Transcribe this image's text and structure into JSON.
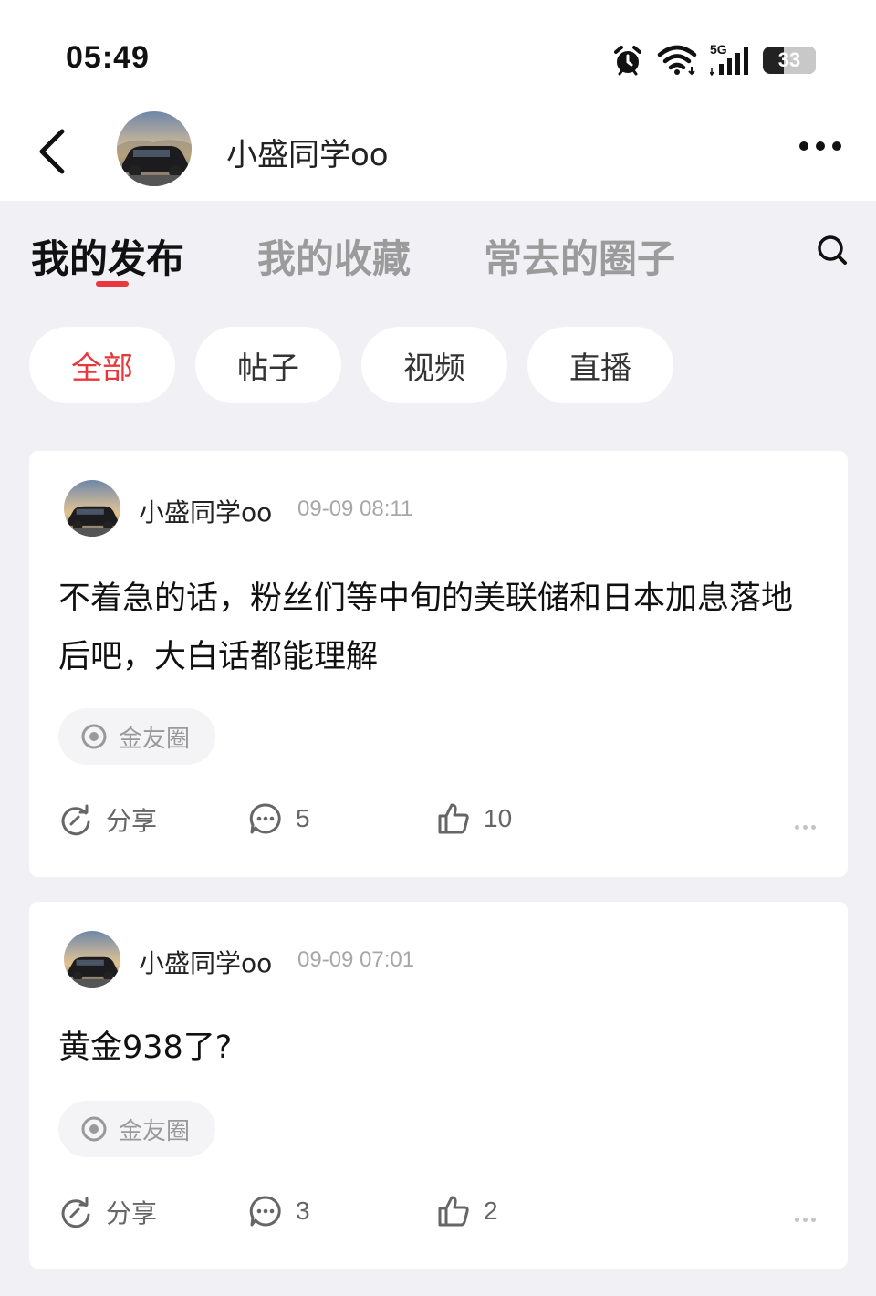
{
  "status_bar": {
    "time": "05:49",
    "network": "5G",
    "battery": "33",
    "icons": [
      "alarm-icon",
      "wifi-icon",
      "signal-icon",
      "battery-icon"
    ]
  },
  "header": {
    "username": "小盛同学oo",
    "back_icon": "chevron-left-icon",
    "more_icon": "more-dots-icon"
  },
  "tabs": [
    {
      "label": "我的发布",
      "active": true
    },
    {
      "label": "我的收藏",
      "active": false
    },
    {
      "label": "常去的圈子",
      "active": false
    }
  ],
  "filters": [
    {
      "label": "全部",
      "active": true
    },
    {
      "label": "帖子",
      "active": false
    },
    {
      "label": "视频",
      "active": false
    },
    {
      "label": "直播",
      "active": false
    }
  ],
  "posts": [
    {
      "author": "小盛同学oo",
      "time": "09-09 08:11",
      "text": "不着急的话，粉丝们等中旬的美联储和日本加息落地后吧，大白话都能理解",
      "circle": "金友圈",
      "share_label": "分享",
      "comments": "5",
      "likes": "10"
    },
    {
      "author": "小盛同学oo",
      "time": "09-09 07:01",
      "text": "黄金938了?",
      "circle": "金友圈",
      "share_label": "分享",
      "comments": "3",
      "likes": "2"
    }
  ],
  "colors": {
    "accent": "#e8383b",
    "background": "#f1f1f5",
    "card": "#ffffff",
    "muted_text": "#a7a7a7"
  }
}
